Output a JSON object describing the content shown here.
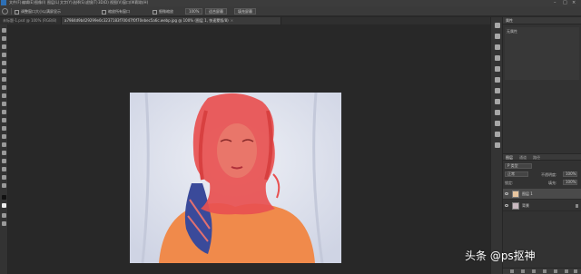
{
  "menubar": {
    "items": [
      "文件(F)",
      "编辑(E)",
      "图像(I)",
      "图层(L)",
      "文字(Y)",
      "选择(S)",
      "滤镜(T)",
      "3D(D)",
      "视图(V)",
      "窗口(W)",
      "帮助(H)"
    ]
  },
  "options": {
    "checkbox_label": "调整窗口大小以满屏显示",
    "checkbox2_label": "缩放所有窗口",
    "checkbox3_label": "细微缩放",
    "zoom_btn": "100%",
    "fit_btn": "适合屏幕",
    "fill_btn": "填充屏幕"
  },
  "tabs": [
    {
      "label": "未标题-1.psd @ 100% (RGB/8)",
      "active": false
    },
    {
      "label": "a7984d9b429299e0c3237183f70047f0f70ebec5a6c.webp.jpg @ 100% (图层 1, 快速蒙版/8)",
      "active": true
    }
  ],
  "panel": {
    "properties_title": "属性",
    "properties_text": "无属性",
    "layer_tabs": [
      "图层",
      "通道",
      "路径"
    ],
    "kind_label": "P 类型",
    "blend_mode": "正常",
    "opacity_label": "不透明度:",
    "opacity_value": "100%",
    "lock_label": "锁定:",
    "fill_label": "填充:",
    "fill_value": "100%",
    "layers": [
      {
        "name": "图层 1",
        "selected": true
      },
      {
        "name": "背景",
        "selected": false
      }
    ]
  },
  "watermark": "头条 @ps抠神",
  "colors": {
    "mask_overlay": "#e85050",
    "shirt": "#f08a4b",
    "scarf": "#3a4a9a",
    "backdrop": "#dde1ee"
  }
}
